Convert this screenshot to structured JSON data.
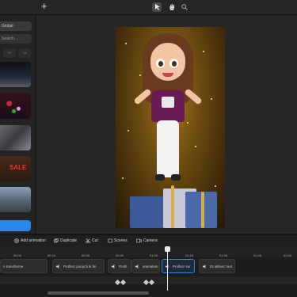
{
  "toolbar_top": {
    "add_glyph": "+",
    "tools": [
      "pointer-icon",
      "hand-icon",
      "search-icon"
    ]
  },
  "sidebar": {
    "global_label": "Global",
    "search_placeholder": "Search...",
    "chips": [
      "Pd",
      "3d",
      "Bg"
    ],
    "sale_text": "SALE"
  },
  "actions": {
    "add_animation": "Add animation",
    "duplicate": "Duplicate",
    "cut": "Cut",
    "scenes": "Scenes",
    "camera": "Camera"
  },
  "timeline": {
    "ticks": [
      "00:00",
      "00:15",
      "00:30",
      "00:45",
      "01:00",
      "01:15",
      "01:30",
      "01:45",
      "02:00",
      "02:15",
      "02:30",
      "02:45"
    ],
    "clips": [
      {
        "label": "n transforme"
      },
      {
        "label": "Profitez jusqu'à le fin"
      },
      {
        "label": "Profit"
      },
      {
        "label": "animation"
      },
      {
        "label": "Profitez sur"
      },
      {
        "label": "Et utilisez tout"
      }
    ]
  },
  "colors": {
    "accent": "#2a86e8",
    "gold": "#a8781e",
    "shirt": "#6a1a54"
  }
}
